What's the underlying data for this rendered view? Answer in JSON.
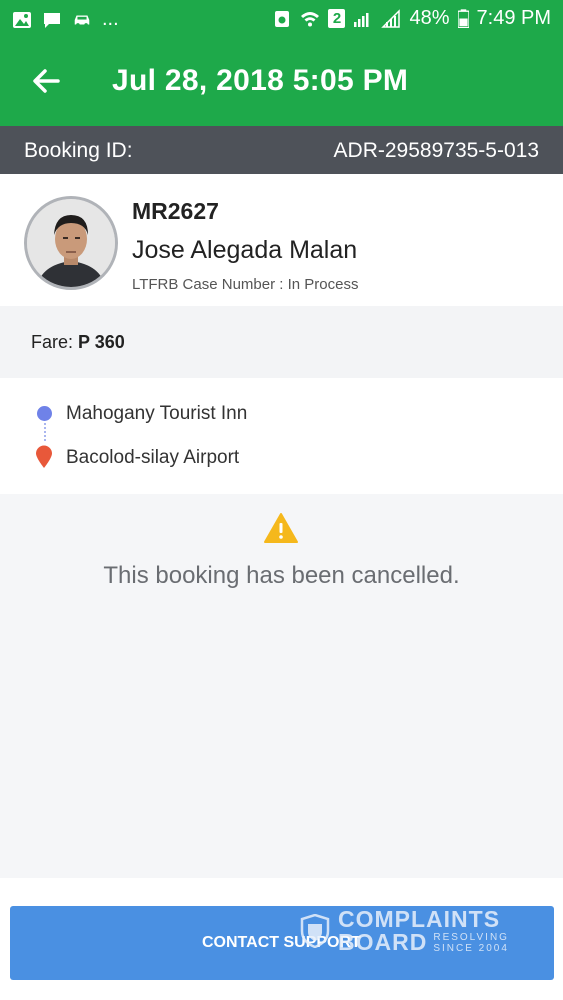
{
  "status_bar": {
    "left_icons": [
      "image-icon",
      "chat-icon",
      "car-icon"
    ],
    "more": "...",
    "sim_badge": "2",
    "battery": "48%",
    "time": "7:49 PM"
  },
  "app_bar": {
    "title": "Jul 28, 2018 5:05 PM",
    "back_icon": "arrow-left-icon"
  },
  "booking": {
    "label": "Booking ID:",
    "id": "ADR-29589735-5-013"
  },
  "driver": {
    "plate": "MR2627",
    "name": "Jose Alegada Malan",
    "case_number": "LTFRB Case Number : In Process"
  },
  "fare": {
    "label": "Fare:",
    "value": "P 360"
  },
  "route": {
    "pickup": "Mahogany Tourist Inn",
    "dropoff": "Bacolod-silay Airport",
    "pickup_color": "#6f82e8",
    "dropoff_color": "#e8583a"
  },
  "status": {
    "icon": "warning-icon",
    "message": "This booking has been cancelled."
  },
  "actions": {
    "contact_support": "CONTACT SUPPORT"
  },
  "watermark": {
    "line1": "COMPLAINTS",
    "line2": "BOARD",
    "tag1": "RESOLVING",
    "tag2": "SINCE 2004"
  },
  "colors": {
    "brand_green": "#1ea94a",
    "booking_bar": "#4e5259",
    "button_blue": "#4a90e2",
    "warning_yellow": "#f5b81c"
  }
}
